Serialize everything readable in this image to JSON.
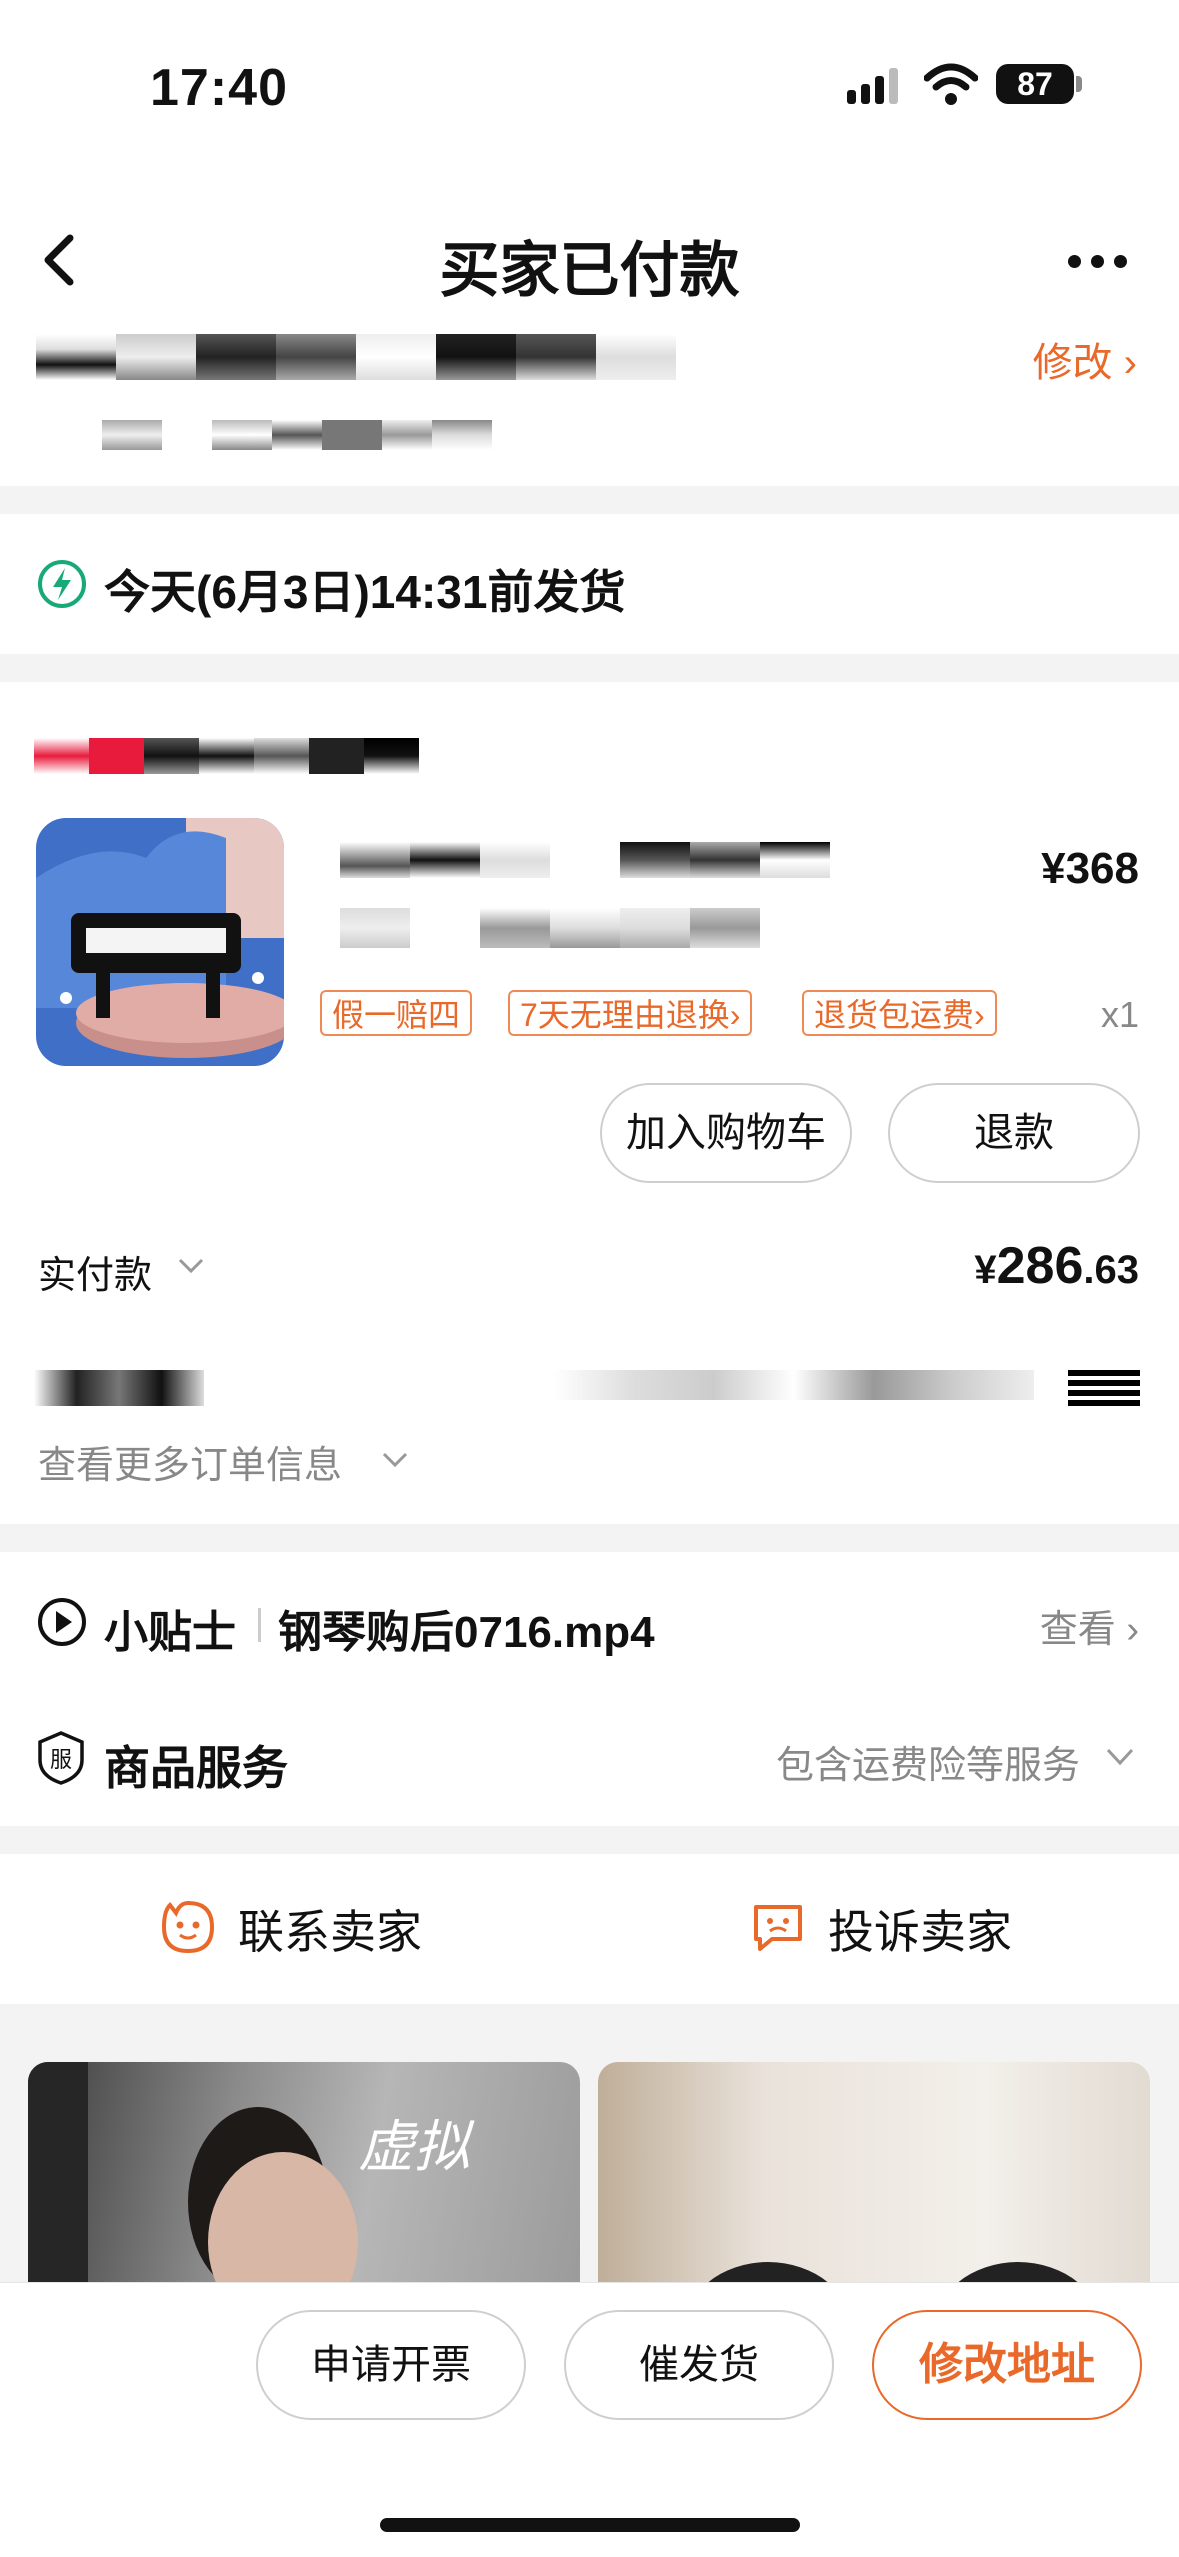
{
  "status_bar": {
    "time": "17:40",
    "battery": "87"
  },
  "nav": {
    "title": "买家已付款"
  },
  "address": {
    "edit_label": "修改 ›"
  },
  "shipping": {
    "notice": "今天(6月3日)14:31前发货"
  },
  "product": {
    "price": "¥368",
    "quantity": "x1",
    "tags": [
      "假一赔四",
      "7天无理由退换›",
      "退货包运费›"
    ],
    "add_to_cart_label": "加入购物车",
    "refund_label": "退款"
  },
  "payment": {
    "label": "实付款",
    "currency": "¥",
    "amount_int": "286",
    "amount_dec": ".63"
  },
  "order_info": {
    "more_label": "查看更多订单信息"
  },
  "tips": {
    "label": "小贴士",
    "file": "钢琴购后0716.mp4",
    "view_label": "查看 ›"
  },
  "service": {
    "label": "商品服务",
    "summary": "包含运费险等服务"
  },
  "contact": {
    "seller_label": "联系卖家",
    "complain_label": "投诉卖家"
  },
  "recommend": {
    "watermark": "虚拟"
  },
  "bottom": {
    "invoice_label": "申请开票",
    "urge_label": "催发货",
    "edit_address_label": "修改地址"
  },
  "colors": {
    "accent": "#e8692a",
    "green": "#17a97a"
  }
}
